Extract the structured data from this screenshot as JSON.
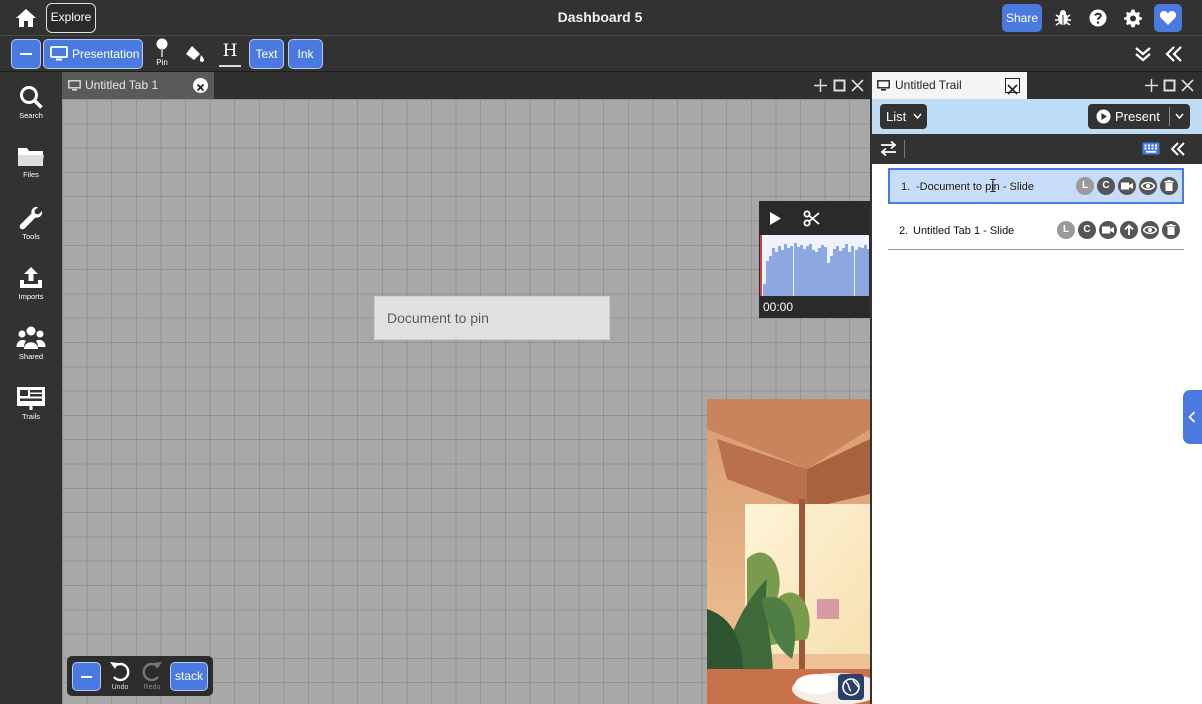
{
  "topbar": {
    "explore_label": "Explore",
    "title": "Dashboard 5",
    "share_label": "Share",
    "icons": [
      "home-icon",
      "bug-icon",
      "help-icon",
      "gear-icon",
      "heart-icon"
    ]
  },
  "toolbar": {
    "presentation_label": "Presentation",
    "pin_label": "Pin",
    "header_glyph": "H",
    "text_label": "Text",
    "ink_label": "Ink"
  },
  "sidebar": {
    "items": [
      {
        "label": "Search",
        "icon": "search-icon"
      },
      {
        "label": "Files",
        "icon": "folder-icon"
      },
      {
        "label": "Tools",
        "icon": "wrench-icon"
      },
      {
        "label": "Imports",
        "icon": "upload-icon"
      },
      {
        "label": "Shared",
        "icon": "users-icon"
      },
      {
        "label": "Trails",
        "icon": "trails-icon"
      }
    ]
  },
  "canvas_tab": {
    "label": "Untitled Tab 1"
  },
  "canvas": {
    "document_text": "Document to pin",
    "media_time": "00:00"
  },
  "bottom_controls": {
    "undo_label": "Undo",
    "redo_label": "Redo",
    "stack_label": "stack"
  },
  "trail_tab": {
    "label": "Untitled Trail"
  },
  "trail": {
    "view_label": "List",
    "present_label": "Present",
    "slides": [
      {
        "number": "1.",
        "title": "-Document to pin - Slide",
        "badges": [
          "L",
          "C"
        ]
      },
      {
        "number": "2.",
        "title": "Untitled Tab 1 - Slide",
        "badges": [
          "L",
          "C"
        ]
      }
    ]
  },
  "colors": {
    "accent": "#4a7ae0",
    "chrome": "#323232",
    "canvas": "#a8a8a8",
    "trail_header": "#bfdcf5",
    "selected_slide": "#c7ddf7"
  }
}
